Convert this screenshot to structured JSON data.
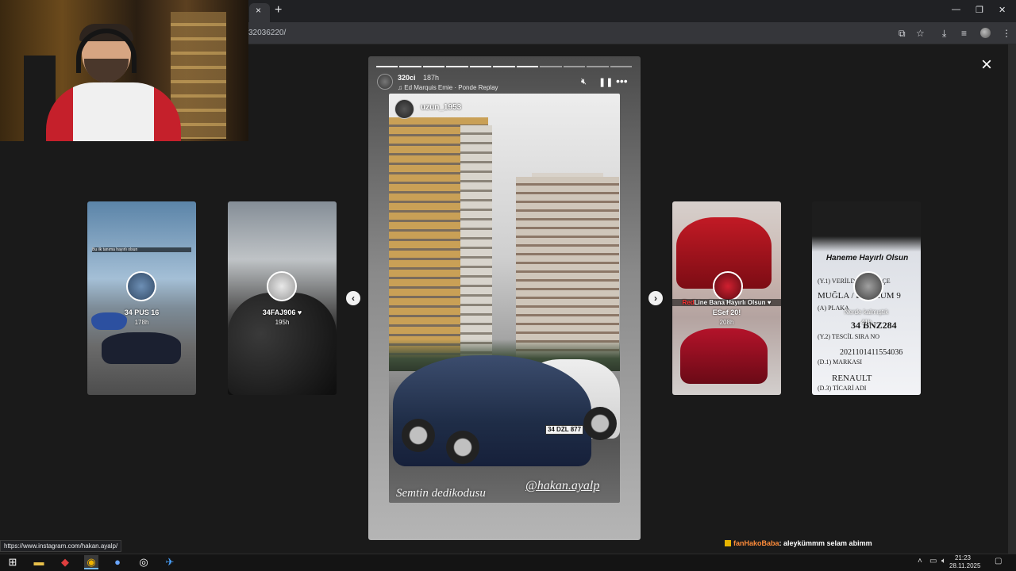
{
  "browser": {
    "url_partial": "32036220/",
    "tab_close": "×",
    "new_tab": "+",
    "icons": [
      "install-app-icon",
      "star-icon",
      "download-icon",
      "media-icon",
      "profile-icon",
      "menu-icon"
    ]
  },
  "viewer": {
    "close": "×",
    "prev_arrow": "‹",
    "next_arrow": "›"
  },
  "main_story": {
    "username": "320ci",
    "time": "187h",
    "music": "Ed Marquis Emie · Ponde Replay",
    "mention_username": "uzun_1953",
    "caption_left": "Semtin dedikodusu",
    "caption_right": "@hakan.ayalp",
    "plate": "34 DZL 877",
    "progress_total": 11,
    "progress_done": 7
  },
  "side_stories": [
    {
      "handle": "34 PUS 16",
      "time": "178h",
      "sticker": "Bu ilk tanıma hayırlı olsun"
    },
    {
      "handle": "34FAJ906 ♥",
      "time": "195h"
    },
    {
      "handle": "ESef 20!",
      "time": "208h",
      "banner_red": "Red",
      "banner_rest": "Line Bana Hayırlı Olsun ♥"
    },
    {
      "handle": "Nerde kalmıştık",
      "time": "41h"
    }
  ],
  "document_card": {
    "title_italic": "Haneme Hayırlı Olsun",
    "lines": [
      "(Y.1) VERİLDİĞİ İL / İLÇE",
      "MUĞLA / BODRUM 9",
      "(A) PLAKA",
      "34 BNZ284",
      "(Y.2) TESCİL SIRA NO",
      "2021101411554036",
      "(D.1) MARKASI",
      "RENAULT",
      "(D.3) TİCARİ ADI"
    ]
  },
  "status_bar": {
    "url": "https://www.instagram.com/hakan.ayalp/"
  },
  "chat": {
    "name": "fanHakoBaba",
    "message": ": aleykümmm selam abimm"
  },
  "taskbar": {
    "time": "21:23",
    "date": "28.11.2025"
  }
}
